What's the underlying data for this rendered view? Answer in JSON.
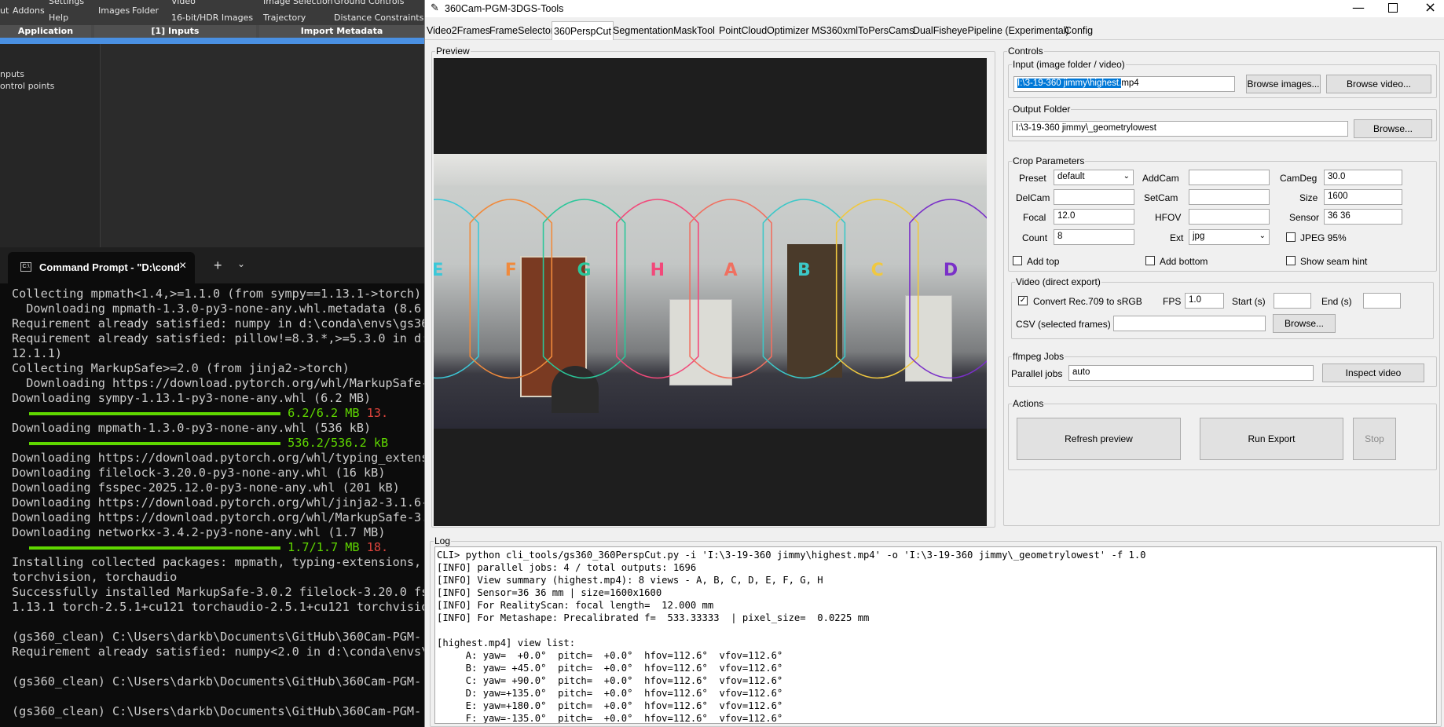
{
  "background_app": {
    "ribbon": [
      "ut",
      "Addons",
      "Settings",
      "Help",
      "Images",
      "Folder",
      "Video",
      "16-bit/HDR Images",
      "Image Selection",
      "Trajectory",
      "Ground Controls",
      "Distance Constraints"
    ],
    "panels": [
      "Application",
      "[1] Inputs",
      "Import Metadata"
    ],
    "left_items": [
      "nputs",
      "ontrol points"
    ]
  },
  "terminal": {
    "tab_title": "Command Prompt - \"D:\\cond",
    "lines": [
      "Collecting mpmath<1.4,>=1.1.0 (from sympy==1.13.1->torch)",
      "  Downloading mpmath-1.3.0-py3-none-any.whl.metadata (8.6",
      "Requirement already satisfied: numpy in d:\\conda\\envs\\gs36",
      "Requirement already satisfied: pillow!=8.3.*,>=5.3.0 in d:",
      "12.1.1)",
      "Collecting MarkupSafe>=2.0 (from jinja2->torch)",
      "  Downloading https://download.pytorch.org/whl/MarkupSafe-",
      "Downloading sympy-1.13.1-py3-none-any.whl (6.2 MB)",
      "",
      "Downloading mpmath-1.3.0-py3-none-any.whl (536 kB)",
      "",
      "Downloading https://download.pytorch.org/whl/typing_extens",
      "Downloading filelock-3.20.0-py3-none-any.whl (16 kB)",
      "Downloading fsspec-2025.12.0-py3-none-any.whl (201 kB)",
      "Downloading https://download.pytorch.org/whl/jinja2-3.1.6-",
      "Downloading https://download.pytorch.org/whl/MarkupSafe-3.",
      "Downloading networkx-3.4.2-py3-none-any.whl (1.7 MB)",
      "",
      "Installing collected packages: mpmath, typing-extensions,",
      "torchvision, torchaudio",
      "Successfully installed MarkupSafe-3.0.2 filelock-3.20.0 fs",
      "1.13.1 torch-2.5.1+cu121 torchaudio-2.5.1+cu121 torchvisio",
      "",
      "(gs360_clean) C:\\Users\\darkb\\Documents\\GitHub\\360Cam-PGM-",
      "Requirement already satisfied: numpy<2.0 in d:\\conda\\envs\\",
      "",
      "(gs360_clean) C:\\Users\\darkb\\Documents\\GitHub\\360Cam-PGM-",
      "",
      "(gs360_clean) C:\\Users\\darkb\\Documents\\GitHub\\360Cam-PGM-"
    ],
    "progress": [
      {
        "line": 8,
        "fill": 1.0,
        "text": "6.2/6.2 MB",
        "rate": "13."
      },
      {
        "line": 10,
        "fill": 1.0,
        "text": "536.2/536.2 kB",
        "rate": ""
      },
      {
        "line": 17,
        "fill": 1.0,
        "text": "1.7/1.7 MB",
        "rate": "18."
      }
    ]
  },
  "window": {
    "title": "360Cam-PGM-3DGS-Tools",
    "tabs": [
      "Video2Frames",
      "FrameSelector",
      "360PerspCut",
      "SegmentationMaskTool",
      "PointCloudOptimizer",
      "MS360xmlToPersCams",
      "DualFisheyePipeline (Experimental)",
      "Config"
    ],
    "active_tab": 2
  },
  "preview": {
    "label": "Preview",
    "view_letters": [
      "E",
      "F",
      "G",
      "H",
      "A",
      "B",
      "C",
      "D"
    ],
    "view_colors": [
      "#3cc8d8",
      "#f08a3c",
      "#2bc79a",
      "#f2497a",
      "#f07060",
      "#3cc8c8",
      "#f0c840",
      "#7a30c8"
    ]
  },
  "controls": {
    "label": "Controls",
    "input": {
      "label": "Input (image folder / video)",
      "value_selected": "I:\\3-19-360 jimmy\\highest.",
      "value_rest": "mp4",
      "browse_images": "Browse images...",
      "browse_video": "Browse video..."
    },
    "output": {
      "label": "Output Folder",
      "value": "I:\\3-19-360 jimmy\\_geometrylowest",
      "browse": "Browse..."
    },
    "crop": {
      "label": "Crop Parameters",
      "preset_label": "Preset",
      "preset_value": "default",
      "addcam_label": "AddCam",
      "addcam_value": "",
      "camdeg_label": "CamDeg",
      "camdeg_value": "30.0",
      "delcam_label": "DelCam",
      "delcam_value": "",
      "setcam_label": "SetCam",
      "setcam_value": "",
      "size_label": "Size",
      "size_value": "1600",
      "focal_label": "Focal",
      "focal_value": "12.0",
      "hfov_label": "HFOV",
      "hfov_value": "",
      "sensor_label": "Sensor",
      "sensor_value": "36 36",
      "count_label": "Count",
      "count_value": "8",
      "ext_label": "Ext",
      "ext_value": "jpg",
      "jpeg_label": "JPEG 95%",
      "jpeg_checked": false,
      "addtop_label": "Add top",
      "addtop_checked": false,
      "addbottom_label": "Add bottom",
      "addbottom_checked": false,
      "seam_label": "Show seam hint",
      "seam_checked": false
    },
    "video": {
      "label": "Video (direct export)",
      "convert_label": "Convert Rec.709 to sRGB",
      "convert_checked": true,
      "fps_label": "FPS",
      "fps_value": "1.0",
      "start_label": "Start (s)",
      "start_value": "",
      "end_label": "End (s)",
      "end_value": "",
      "csv_label": "CSV (selected frames)",
      "csv_value": "",
      "browse": "Browse..."
    },
    "ffmpeg": {
      "label": "ffmpeg Jobs",
      "parallel_label": "Parallel jobs",
      "parallel_value": "auto",
      "inspect": "Inspect video"
    },
    "actions": {
      "label": "Actions",
      "refresh": "Refresh preview",
      "run": "Run Export",
      "stop": "Stop"
    }
  },
  "log": {
    "label": "Log",
    "lines": [
      "CLI> python cli_tools/gs360_360PerspCut.py -i 'I:\\3-19-360 jimmy\\highest.mp4' -o 'I:\\3-19-360 jimmy\\_geometrylowest' -f 1.0",
      "[INFO] parallel jobs: 4 / total outputs: 1696",
      "[INFO] View summary (highest.mp4): 8 views - A, B, C, D, E, F, G, H",
      "[INFO] Sensor=36 36 mm | size=1600x1600",
      "[INFO] For RealityScan: focal length=  12.000 mm",
      "[INFO] For Metashape: Precalibrated f=  533.33333  | pixel_size=  0.0225 mm",
      "",
      "[highest.mp4] view list:",
      "     A: yaw=  +0.0°  pitch=  +0.0°  hfov=112.6°  vfov=112.6°",
      "     B: yaw= +45.0°  pitch=  +0.0°  hfov=112.6°  vfov=112.6°",
      "     C: yaw= +90.0°  pitch=  +0.0°  hfov=112.6°  vfov=112.6°",
      "     D: yaw=+135.0°  pitch=  +0.0°  hfov=112.6°  vfov=112.6°",
      "     E: yaw=+180.0°  pitch=  +0.0°  hfov=112.6°  vfov=112.6°",
      "     F: yaw=-135.0°  pitch=  +0.0°  hfov=112.6°  vfov=112.6°"
    ]
  }
}
